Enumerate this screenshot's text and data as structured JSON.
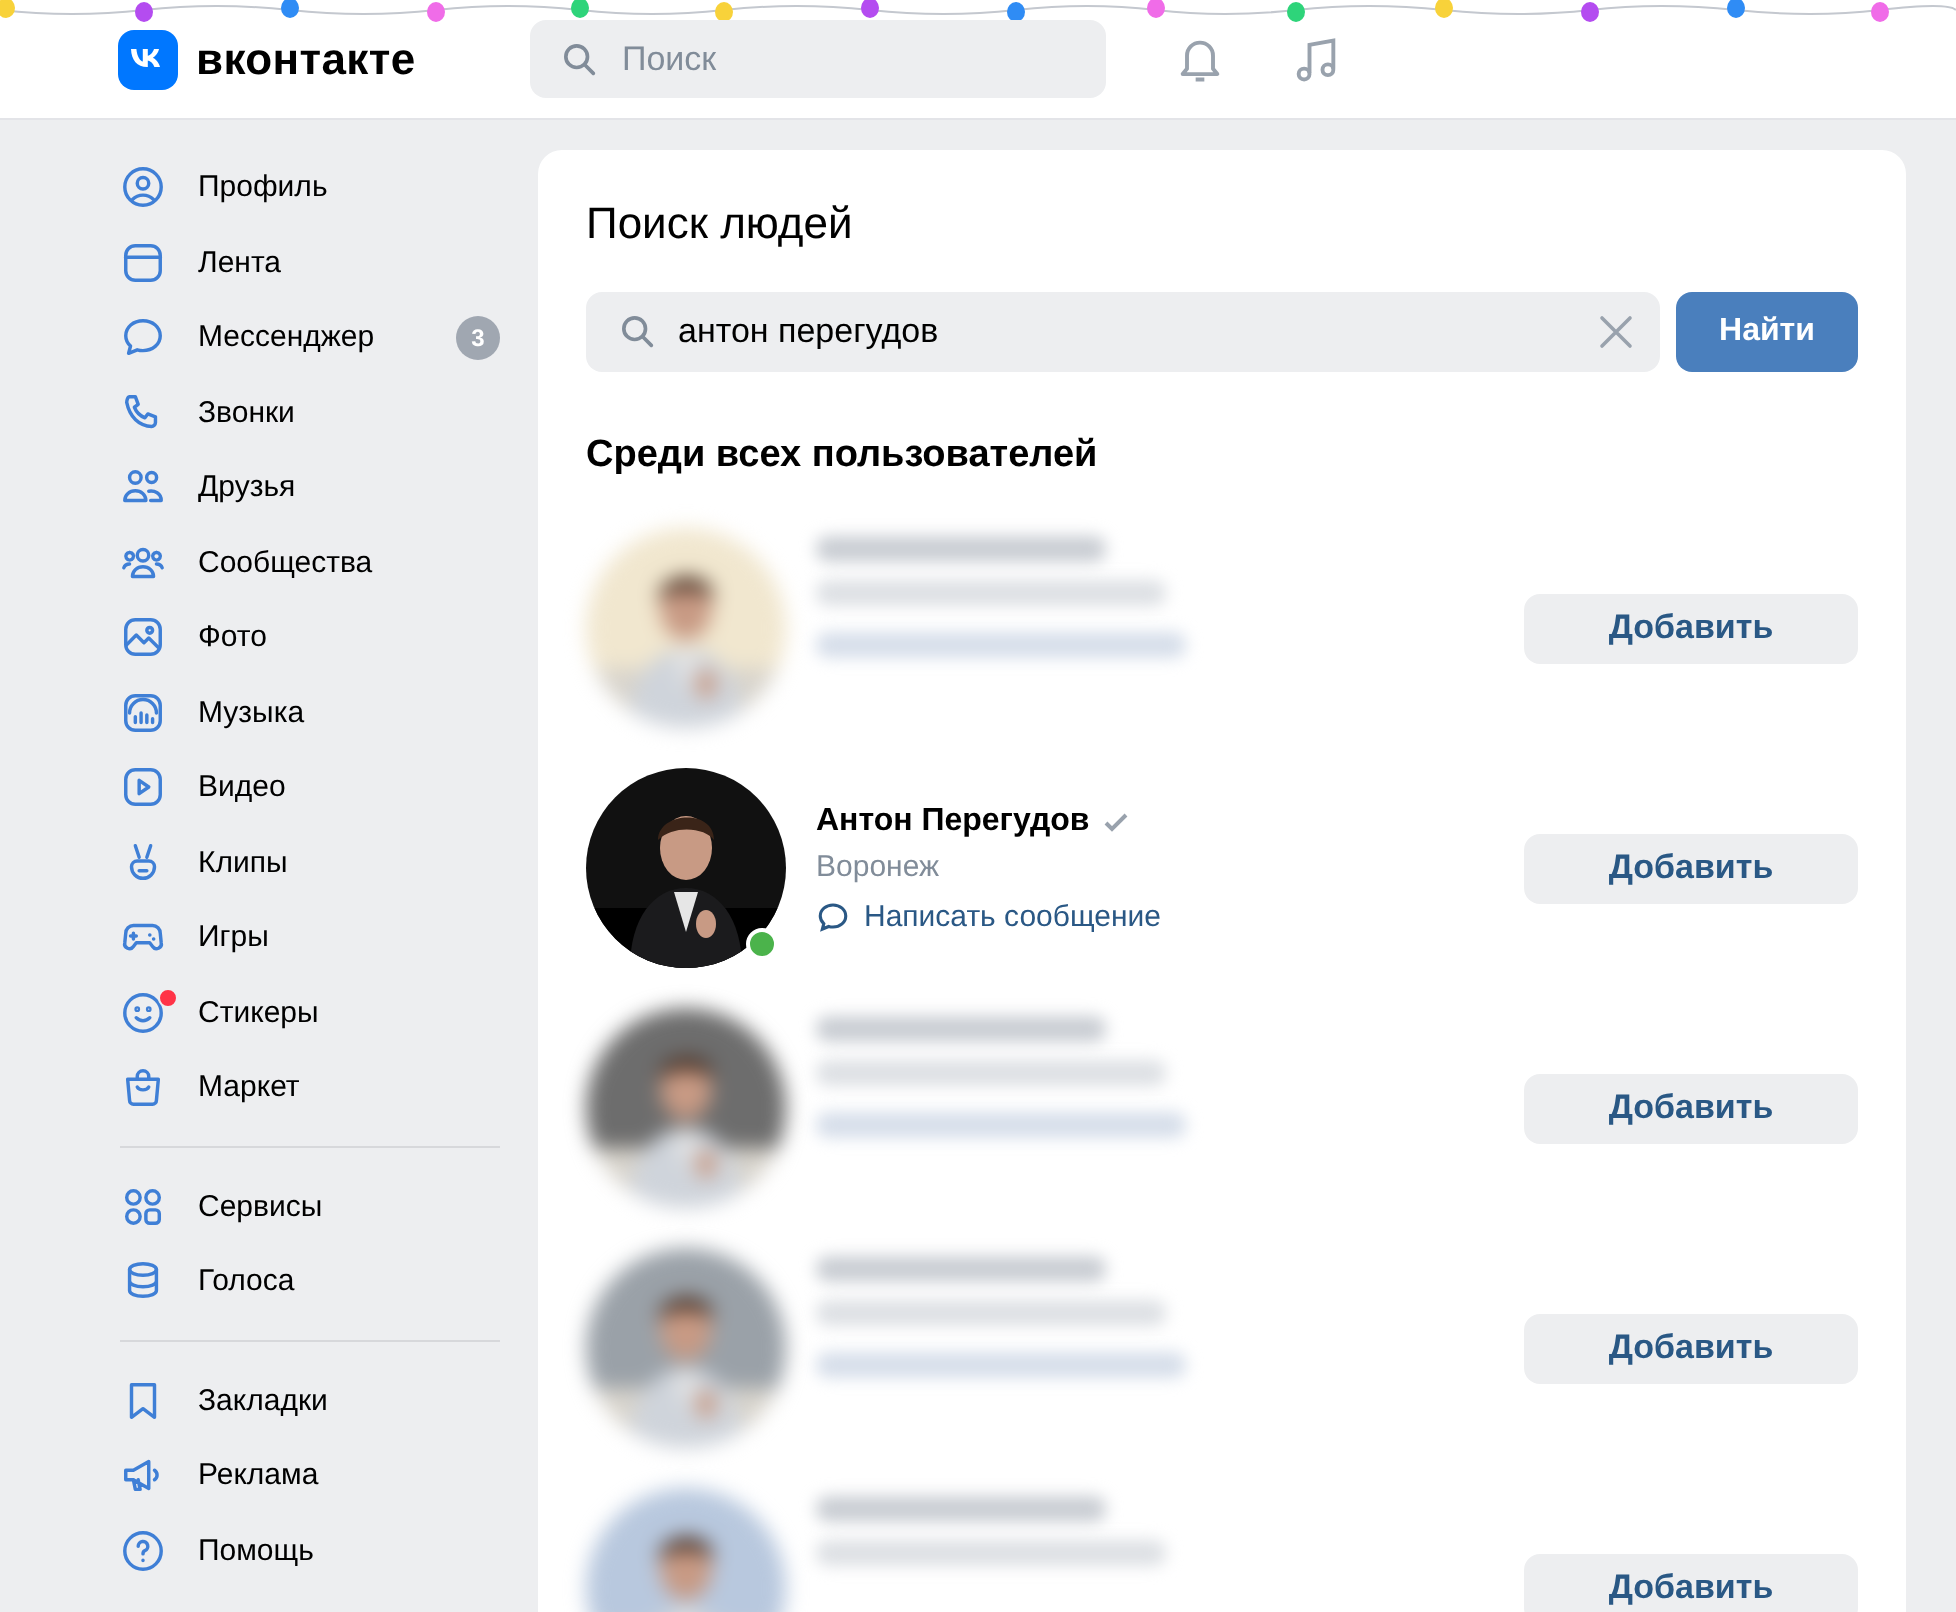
{
  "header": {
    "logo_text": "вконтакте",
    "search": {
      "placeholder": "Поиск"
    }
  },
  "sidebar": {
    "groups": [
      [
        {
          "label": "Профиль"
        },
        {
          "label": "Лента"
        },
        {
          "label": "Мессенджер",
          "badge": "3"
        },
        {
          "label": "Звонки"
        },
        {
          "label": "Друзья"
        },
        {
          "label": "Сообщества"
        },
        {
          "label": "Фото"
        },
        {
          "label": "Музыка"
        },
        {
          "label": "Видео"
        },
        {
          "label": "Клипы"
        },
        {
          "label": "Игры"
        },
        {
          "label": "Стикеры",
          "notification_dot": true
        },
        {
          "label": "Маркет"
        }
      ],
      [
        {
          "label": "Сервисы"
        },
        {
          "label": "Голоса"
        }
      ],
      [
        {
          "label": "Закладки"
        },
        {
          "label": "Реклама"
        },
        {
          "label": "Помощь"
        }
      ]
    ]
  },
  "search_page": {
    "title": "Поиск людей",
    "query": {
      "value": "антон перегудов"
    },
    "search_button": "Найти",
    "section_title": "Среди всех пользователей",
    "results": [
      {
        "kind": "blurred",
        "lines": [
          {
            "kind": "name"
          },
          {
            "kind": "city"
          },
          {
            "kind": "link"
          }
        ],
        "button": "Добавить"
      },
      {
        "kind": "person",
        "name": "Антон Перегудов",
        "verified": true,
        "online": true,
        "city": "Воронеж",
        "message_link": "Написать сообщение",
        "button": "Добавить"
      },
      {
        "kind": "blurred",
        "lines": [
          {
            "kind": "name"
          },
          {
            "kind": "city"
          },
          {
            "kind": "link"
          }
        ],
        "button": "Добавить"
      },
      {
        "kind": "blurred",
        "lines": [
          {
            "kind": "name"
          },
          {
            "kind": "city"
          },
          {
            "kind": "link"
          }
        ],
        "button": "Добавить"
      },
      {
        "kind": "blurred",
        "lines": [
          {
            "kind": "name"
          },
          {
            "kind": "city"
          }
        ],
        "button": "Добавить"
      }
    ]
  }
}
